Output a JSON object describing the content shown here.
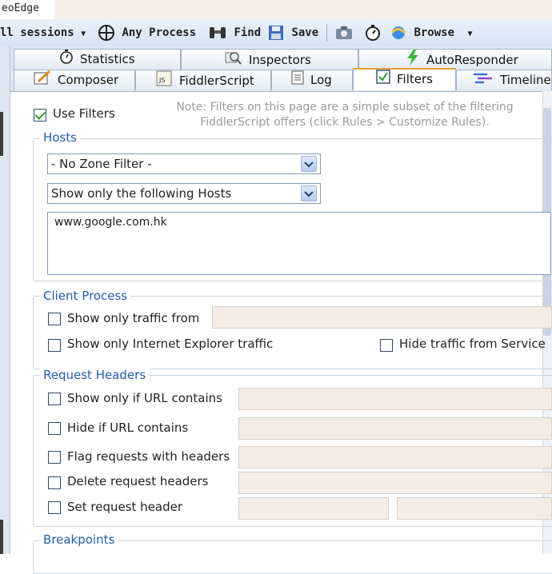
{
  "window": {
    "title_fragment": "eoEdge"
  },
  "toolbar": {
    "sessions_label": "ll sessions",
    "process_label": "Any Process",
    "find_label": "Find",
    "save_label": "Save",
    "browse_label": "Browse"
  },
  "tabs_row1": [
    {
      "label": "Statistics",
      "icon": "stopwatch-icon"
    },
    {
      "label": "Inspectors",
      "icon": "magnifier-icon"
    },
    {
      "label": "AutoResponder",
      "icon": "lightning-icon"
    }
  ],
  "tabs_row2": [
    {
      "label": "Composer",
      "icon": "pencil-icon"
    },
    {
      "label": "FiddlerScript",
      "icon": "js-file-icon"
    },
    {
      "label": "Log",
      "icon": "log-icon"
    },
    {
      "label": "Filters",
      "icon": "checkbox-icon",
      "active": true
    },
    {
      "label": "Timeline",
      "icon": "timeline-icon"
    }
  ],
  "filters": {
    "use_filters_label": "Use Filters",
    "use_filters_checked": true,
    "note_line1": "Note: Filters on this page are a simple subset of the filtering",
    "note_line2": "FiddlerScript offers (click Rules > Customize Rules)."
  },
  "hosts": {
    "title": "Hosts",
    "zone_filter": "- No Zone Filter -",
    "host_filter": "Show only the following Hosts",
    "host_list": "www.google.com.hk"
  },
  "client_process": {
    "title": "Client Process",
    "traffic_from_label": "Show only traffic from",
    "ie_only_label": "Show only Internet Explorer traffic",
    "hide_service_label": "Hide traffic from Service"
  },
  "request_headers": {
    "title": "Request Headers",
    "url_contains_label": "Show only if URL contains",
    "hide_url_label": "Hide if URL contains",
    "flag_headers_label": "Flag requests with headers",
    "delete_headers_label": "Delete request headers",
    "set_header_label": "Set request header"
  },
  "breakpoints": {
    "title": "Breakpoints"
  },
  "colors": {
    "accent": "#1f5fae",
    "field_bg": "#f4ece5",
    "tab_active_border": "#e8a13b"
  }
}
